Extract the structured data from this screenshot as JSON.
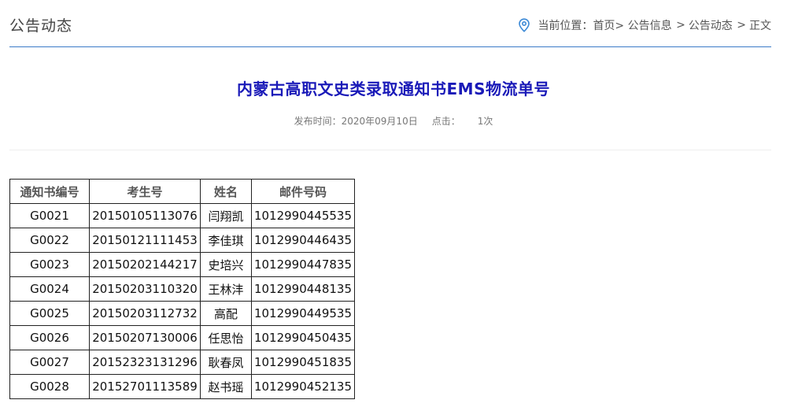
{
  "header": {
    "section_title": "公告动态",
    "breadcrumb": {
      "location_label": "当前位置：",
      "items": [
        "首页>",
        "公告信息",
        ">",
        "公告动态",
        ">",
        "正文"
      ]
    }
  },
  "article": {
    "title": "内蒙古高职文史类录取通知书EMS物流单号",
    "publish_label": "发布时间：",
    "publish_date": "2020年09月10日",
    "clicks_label": "点击：",
    "clicks_value": "1次"
  },
  "table": {
    "headers": [
      "通知书编号",
      "考生号",
      "姓名",
      "邮件号码"
    ],
    "rows": [
      [
        "G0021",
        "20150105113076",
        "闫翔凯",
        "1012990445535"
      ],
      [
        "G0022",
        "20150121111453",
        "李佳琪",
        "1012990446435"
      ],
      [
        "G0023",
        "20150202144217",
        "史培兴",
        "1012990447835"
      ],
      [
        "G0024",
        "20150203110320",
        "王林沣",
        "1012990448135"
      ],
      [
        "G0025",
        "20150203112732",
        "高配",
        "1012990449535"
      ],
      [
        "G0026",
        "20150207130006",
        "任思怡",
        "1012990450435"
      ],
      [
        "G0027",
        "20152323131296",
        "耿春凤",
        "1012990451835"
      ],
      [
        "G0028",
        "20152701113589",
        "赵书瑶",
        "1012990452135"
      ]
    ]
  },
  "icons": {
    "location": "location-pin-icon"
  },
  "colors": {
    "title": "#1a1ab8",
    "header_rule": "#3b7bc8",
    "icon": "#3d8ad6"
  }
}
